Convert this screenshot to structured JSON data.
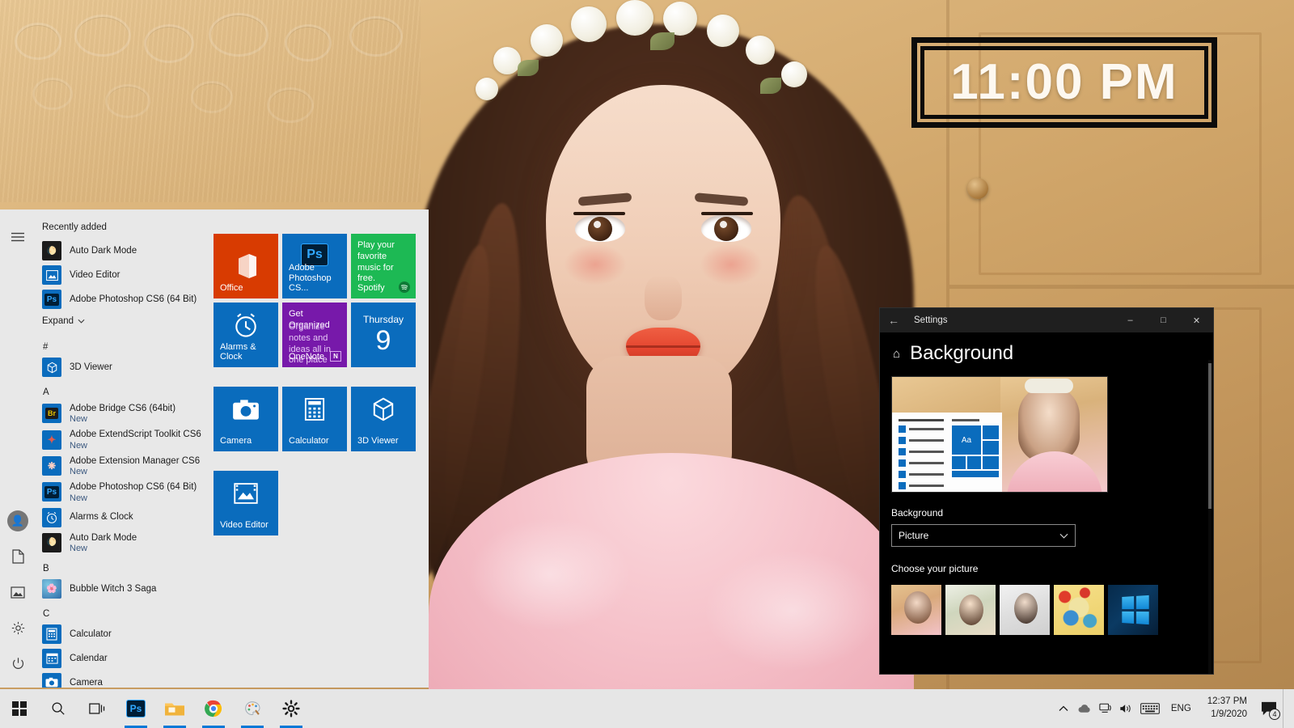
{
  "desktop": {
    "clock_widget": {
      "time": "11:00 PM"
    }
  },
  "start_menu": {
    "rail": [
      {
        "name": "hamburger",
        "icon": "hamburger-icon"
      },
      {
        "name": "user",
        "icon": "user-avatar-icon"
      },
      {
        "name": "documents",
        "icon": "document-icon"
      },
      {
        "name": "pictures",
        "icon": "picture-icon"
      },
      {
        "name": "settings",
        "icon": "gear-icon"
      },
      {
        "name": "power",
        "icon": "power-icon"
      }
    ],
    "recently_added_label": "Recently added",
    "recently_added": [
      {
        "label": "Auto Dark Mode",
        "icon": "moon-icon",
        "color": "#1b1b1b"
      },
      {
        "label": "Video Editor",
        "icon": "video-editor-icon",
        "color": "#0a6cbd"
      },
      {
        "label": "Adobe Photoshop CS6 (64 Bit)",
        "icon": "photoshop-icon",
        "color": "#0a6cbd"
      }
    ],
    "expand_label": "Expand",
    "groups": [
      {
        "heading": "#",
        "apps": [
          {
            "label": "3D Viewer",
            "sub": "",
            "icon": "cube-icon",
            "color": "#0a6cbd"
          }
        ]
      },
      {
        "heading": "A",
        "apps": [
          {
            "label": "Adobe Bridge CS6 (64bit)",
            "sub": "New",
            "icon": "bridge-icon",
            "color": "#0a6cbd"
          },
          {
            "label": "Adobe ExtendScript Toolkit CS6",
            "sub": "New",
            "icon": "extendscript-icon",
            "color": "#0a6cbd"
          },
          {
            "label": "Adobe Extension Manager CS6",
            "sub": "New",
            "icon": "extension-manager-icon",
            "color": "#0a6cbd"
          },
          {
            "label": "Adobe Photoshop CS6 (64 Bit)",
            "sub": "New",
            "icon": "photoshop-icon",
            "color": "#0a6cbd"
          },
          {
            "label": "Alarms & Clock",
            "sub": "",
            "icon": "alarm-clock-icon",
            "color": "#0a6cbd"
          },
          {
            "label": "Auto Dark Mode",
            "sub": "New",
            "icon": "moon-icon",
            "color": "#1b1b1b"
          }
        ]
      },
      {
        "heading": "B",
        "apps": [
          {
            "label": "Bubble Witch 3 Saga",
            "sub": "",
            "icon": "bubble-witch-icon",
            "color": "#3a6fb5"
          }
        ]
      },
      {
        "heading": "C",
        "apps": [
          {
            "label": "Calculator",
            "sub": "",
            "icon": "calculator-icon",
            "color": "#0a6cbd"
          },
          {
            "label": "Calendar",
            "sub": "",
            "icon": "calendar-icon",
            "color": "#0a6cbd"
          },
          {
            "label": "Camera",
            "sub": "",
            "icon": "camera-icon",
            "color": "#0a6cbd"
          }
        ]
      }
    ],
    "tiles": [
      {
        "label": "Office",
        "icon": "office-icon",
        "color": "#d83b01",
        "promo": "",
        "corner": "",
        "kind": "icon"
      },
      {
        "label": "Adobe Photoshop CS...",
        "icon": "photoshop-icon",
        "color": "#0a6cbd",
        "promo": "",
        "corner": "",
        "kind": "icon"
      },
      {
        "label": "Spotify",
        "icon": "spotify-icon",
        "color": "#1db954",
        "promo": "Play your favorite music for free.",
        "corner": "spotify",
        "kind": "promo"
      },
      {
        "label": "Alarms & Clock",
        "icon": "alarm-clock-icon",
        "color": "#0a6cbd",
        "promo": "",
        "corner": "",
        "kind": "icon"
      },
      {
        "label": "OneNote",
        "icon": "onenote-icon",
        "color": "#7719aa",
        "promo": "Get Organized",
        "promo2": "Organize notes and ideas all in one place",
        "corner": "onenote",
        "kind": "promo2"
      },
      {
        "label": "",
        "icon": "calendar-icon",
        "color": "#0a6cbd",
        "dow": "Thursday",
        "day": "9",
        "kind": "calendar"
      },
      {
        "label": "Camera",
        "icon": "camera-icon",
        "color": "#0a6cbd",
        "promo": "",
        "corner": "",
        "kind": "icon"
      },
      {
        "label": "Calculator",
        "icon": "calculator-icon",
        "color": "#0a6cbd",
        "promo": "",
        "corner": "",
        "kind": "icon"
      },
      {
        "label": "3D Viewer",
        "icon": "cube-icon",
        "color": "#0a6cbd",
        "promo": "",
        "corner": "",
        "kind": "icon"
      },
      {
        "label": "Video Editor",
        "icon": "video-editor-icon",
        "color": "#0a6cbd",
        "promo": "",
        "corner": "",
        "kind": "icon"
      }
    ]
  },
  "settings": {
    "window_title": "Settings",
    "back_icon": "back-arrow-icon",
    "minimize_label": "–",
    "maximize_label": "□",
    "close_label": "✕",
    "home_icon": "home-icon",
    "page_title": "Background",
    "background_label": "Background",
    "background_value": "Picture",
    "choose_picture_label": "Choose your picture",
    "thumbnails": [
      {
        "name": "wallpaper-portrait-flowercrown",
        "style": "t1"
      },
      {
        "name": "wallpaper-portrait-hat",
        "style": "t2"
      },
      {
        "name": "wallpaper-portrait-stripes",
        "style": "t3"
      },
      {
        "name": "wallpaper-floral-art",
        "style": "t4"
      },
      {
        "name": "wallpaper-windows-default",
        "style": "t5"
      }
    ]
  },
  "taskbar": {
    "items": [
      {
        "name": "start-button",
        "icon": "windows-logo-icon",
        "active": false
      },
      {
        "name": "search-button",
        "icon": "search-icon",
        "active": false
      },
      {
        "name": "task-view-button",
        "icon": "task-view-icon",
        "active": false
      },
      {
        "name": "photoshop",
        "icon": "photoshop-icon",
        "active": true
      },
      {
        "name": "file-explorer",
        "icon": "folder-icon",
        "active": true
      },
      {
        "name": "chrome",
        "icon": "chrome-icon",
        "active": true
      },
      {
        "name": "paint",
        "icon": "paint-icon",
        "active": true
      },
      {
        "name": "settings",
        "icon": "gear-icon",
        "active": true
      }
    ],
    "tray": {
      "chevron": "chevron-up-icon",
      "onedrive": "cloud-icon",
      "network": "network-icon",
      "volume": "speaker-icon",
      "keyboard": "keyboard-icon",
      "language": "ENG",
      "time": "12:37 PM",
      "date": "1/9/2020",
      "notifications_icon": "action-center-icon",
      "notifications_count": "4"
    }
  }
}
